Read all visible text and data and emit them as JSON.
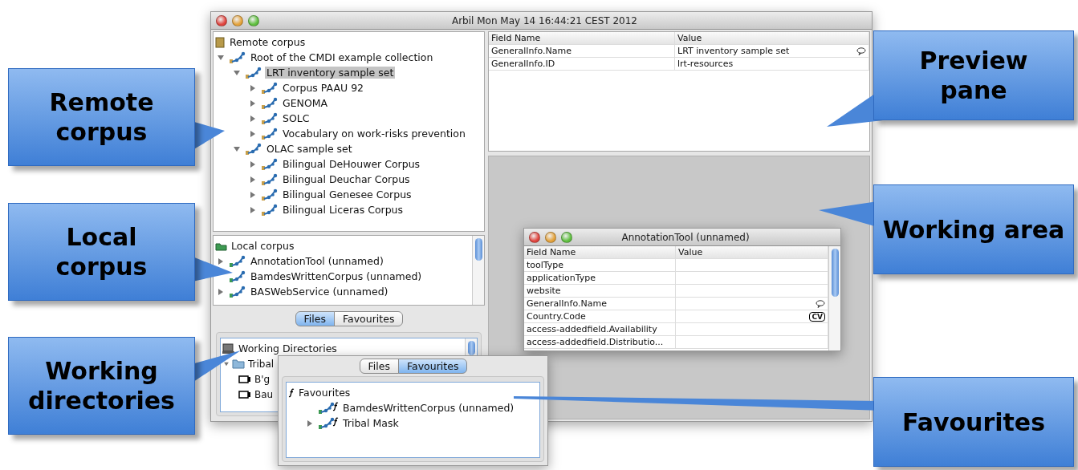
{
  "main_window": {
    "title": "Arbil Mon May 14 16:44:21 CEST 2012",
    "remote_tree": {
      "label": "Remote corpus",
      "children": [
        {
          "label": "Root of the CMDI example collection",
          "expanded": true,
          "selected": false,
          "children": [
            {
              "label": "LRT inventory sample set",
              "expanded": true,
              "selected": true,
              "children": [
                {
                  "label": "Corpus PAAU 92",
                  "expanded": false,
                  "selected": false
                },
                {
                  "label": "GENOMA",
                  "expanded": false,
                  "selected": false
                },
                {
                  "label": "SOLC",
                  "expanded": false,
                  "selected": false
                },
                {
                  "label": "Vocabulary on work-risks prevention",
                  "expanded": false,
                  "selected": false
                }
              ]
            },
            {
              "label": "OLAC sample set",
              "expanded": true,
              "selected": false,
              "children": [
                {
                  "label": "Bilingual DeHouwer Corpus",
                  "expanded": false,
                  "selected": false
                },
                {
                  "label": "Bilingual Deuchar Corpus",
                  "expanded": false,
                  "selected": false
                },
                {
                  "label": "Bilingual Genesee Corpus",
                  "expanded": false,
                  "selected": false
                },
                {
                  "label": "Bilingual Liceras Corpus",
                  "expanded": false,
                  "selected": false
                }
              ]
            }
          ]
        }
      ]
    },
    "local_tree": {
      "label": "Local corpus",
      "children": [
        {
          "label": "AnnotationTool (unnamed)",
          "expanded": false,
          "selected": false
        },
        {
          "label": "BamdesWrittenCorpus (unnamed)",
          "selected": false
        },
        {
          "label": "BASWebService (unnamed)",
          "expanded": false,
          "selected": false
        }
      ]
    },
    "files_panel": {
      "tabs": [
        {
          "label": "Files",
          "selected": true
        },
        {
          "label": "Favourites",
          "selected": false
        }
      ],
      "tree": {
        "label": "Working Directories",
        "children": [
          {
            "label": "Tribal",
            "expanded": true,
            "selected": false,
            "children": [
              {
                "label": "B'g",
                "selected": false
              },
              {
                "label": "Bau",
                "selected": false
              }
            ]
          }
        ]
      }
    },
    "preview_table": {
      "columns": [
        "Field Name",
        "Value"
      ],
      "rows": [
        {
          "field": "GeneralInfo.Name",
          "value": "LRT inventory sample set",
          "has_note": true
        },
        {
          "field": "GeneralInfo.ID",
          "value": "lrt-resources"
        }
      ]
    }
  },
  "annotation_window": {
    "title": "AnnotationTool (unnamed)",
    "columns": [
      "Field Name",
      "Value"
    ],
    "rows": [
      {
        "field": "toolType",
        "value": ""
      },
      {
        "field": "applicationType",
        "value": ""
      },
      {
        "field": "website",
        "value": ""
      },
      {
        "field": "GeneralInfo.Name",
        "value": "",
        "has_note": true
      },
      {
        "field": "Country.Code",
        "value": "",
        "badge": "CV"
      },
      {
        "field": "access-addedfield.Availability",
        "value": ""
      },
      {
        "field": "access-addedfield.Distributio...",
        "value": ""
      }
    ]
  },
  "favourites_window": {
    "tabs": [
      {
        "label": "Files",
        "selected": false
      },
      {
        "label": "Favourites",
        "selected": true
      }
    ],
    "tree": {
      "label": "Favourites",
      "children": [
        {
          "label": "BamdesWrittenCorpus (unnamed)",
          "selected": false
        },
        {
          "label": "Tribal Mask",
          "expanded": false,
          "selected": false
        }
      ]
    }
  },
  "callouts": [
    {
      "text": "Remote corpus"
    },
    {
      "text": "Local corpus"
    },
    {
      "text": "Working directories"
    },
    {
      "text": "Preview pane"
    },
    {
      "text": "Working area"
    },
    {
      "text": "Favourites"
    }
  ]
}
